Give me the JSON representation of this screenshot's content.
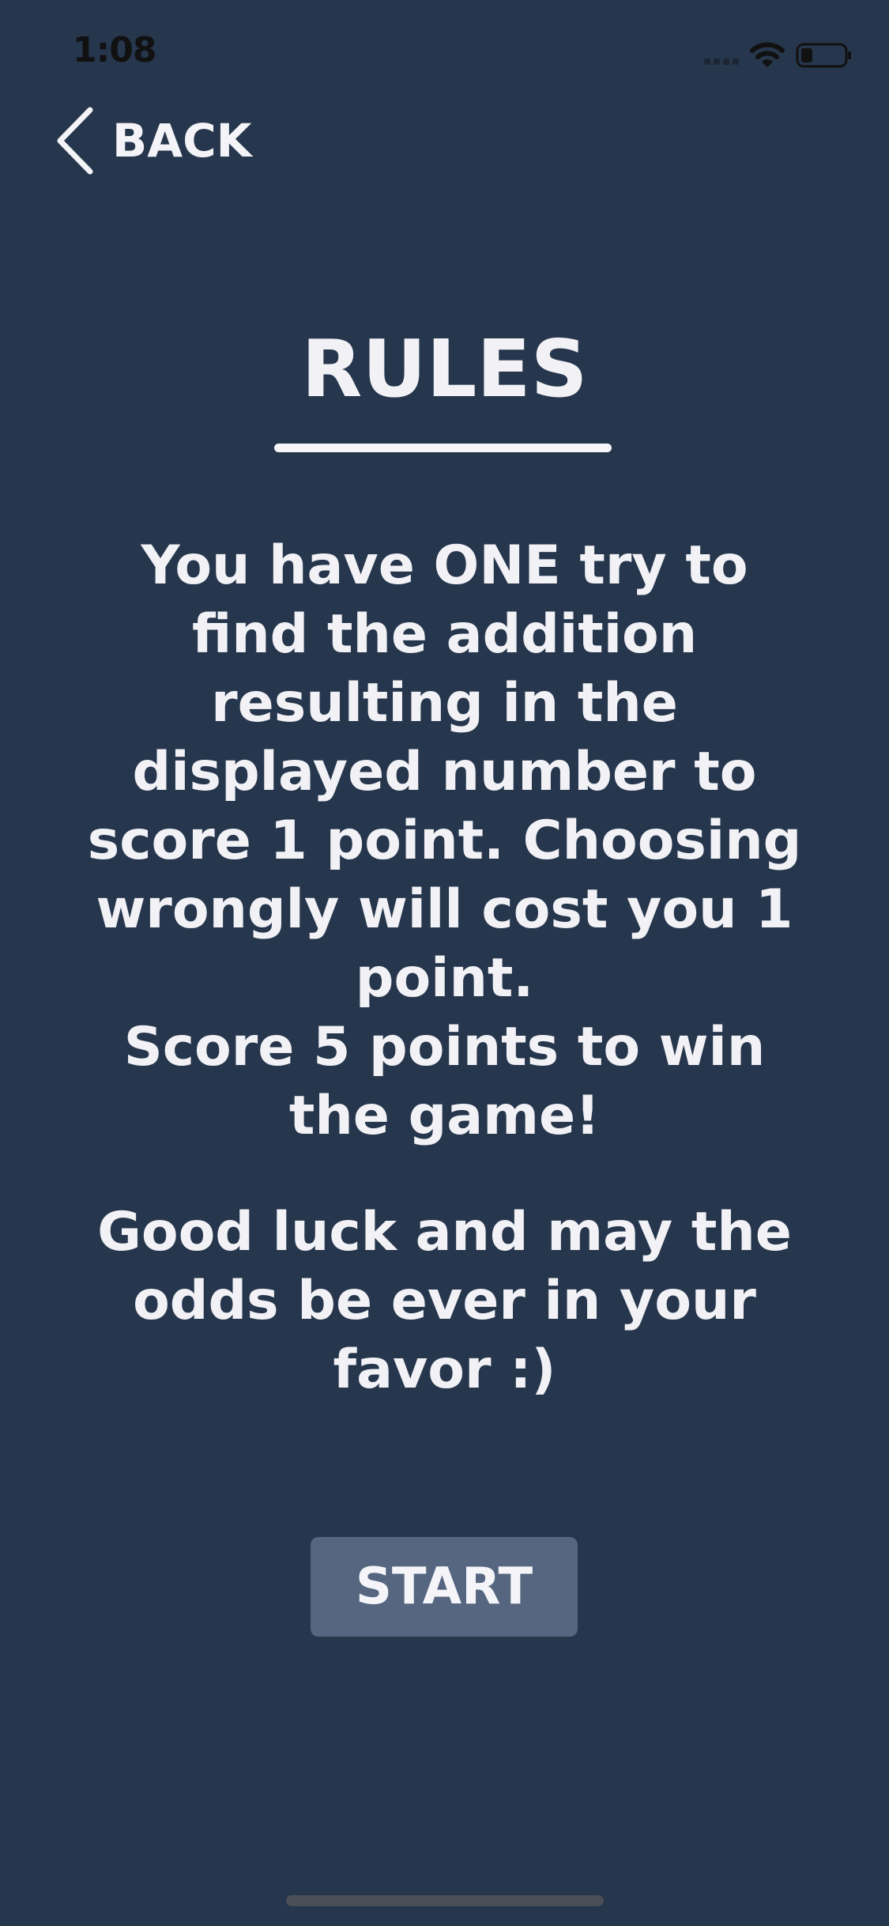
{
  "status_bar": {
    "time": "1:08"
  },
  "nav": {
    "back_label": "BACK"
  },
  "title": "RULES",
  "rules": {
    "text": "You have ONE try to find the addition resulting in the displayed number to score 1 point. Choosing wrongly will cost you 1 point.\nScore 5 points to win the game!",
    "luck": "Good luck and may the odds be ever in your favor :)"
  },
  "start_button": {
    "label": "START"
  },
  "colors": {
    "background": "#26364c",
    "button": "#566680",
    "text": "#f1f1f6"
  }
}
